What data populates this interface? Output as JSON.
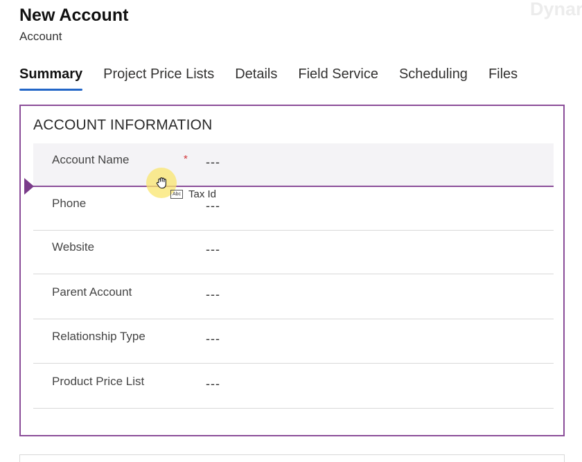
{
  "header": {
    "title": "New Account",
    "subtitle": "Account",
    "watermark": "Dynar"
  },
  "tabs": [
    {
      "label": "Summary",
      "active": true
    },
    {
      "label": "Project Price Lists",
      "active": false
    },
    {
      "label": "Details",
      "active": false
    },
    {
      "label": "Field Service",
      "active": false
    },
    {
      "label": "Scheduling",
      "active": false
    },
    {
      "label": "Files",
      "active": false
    }
  ],
  "section": {
    "title": "ACCOUNT INFORMATION",
    "fields": [
      {
        "label": "Account Name",
        "required": "*",
        "value": "---"
      },
      {
        "label": "Phone",
        "value": "---"
      },
      {
        "label": "Website",
        "value": "---"
      },
      {
        "label": "Parent Account",
        "value": "---"
      },
      {
        "label": "Relationship Type",
        "value": "---"
      },
      {
        "label": "Product Price List",
        "value": "---"
      }
    ]
  },
  "drag": {
    "icon_text": "Abc",
    "label": "Tax Id"
  },
  "colors": {
    "accent_border": "#8a4c98",
    "tab_underline": "#2266c7",
    "required_star": "#d13438",
    "cursor_highlight": "#fae66e"
  }
}
